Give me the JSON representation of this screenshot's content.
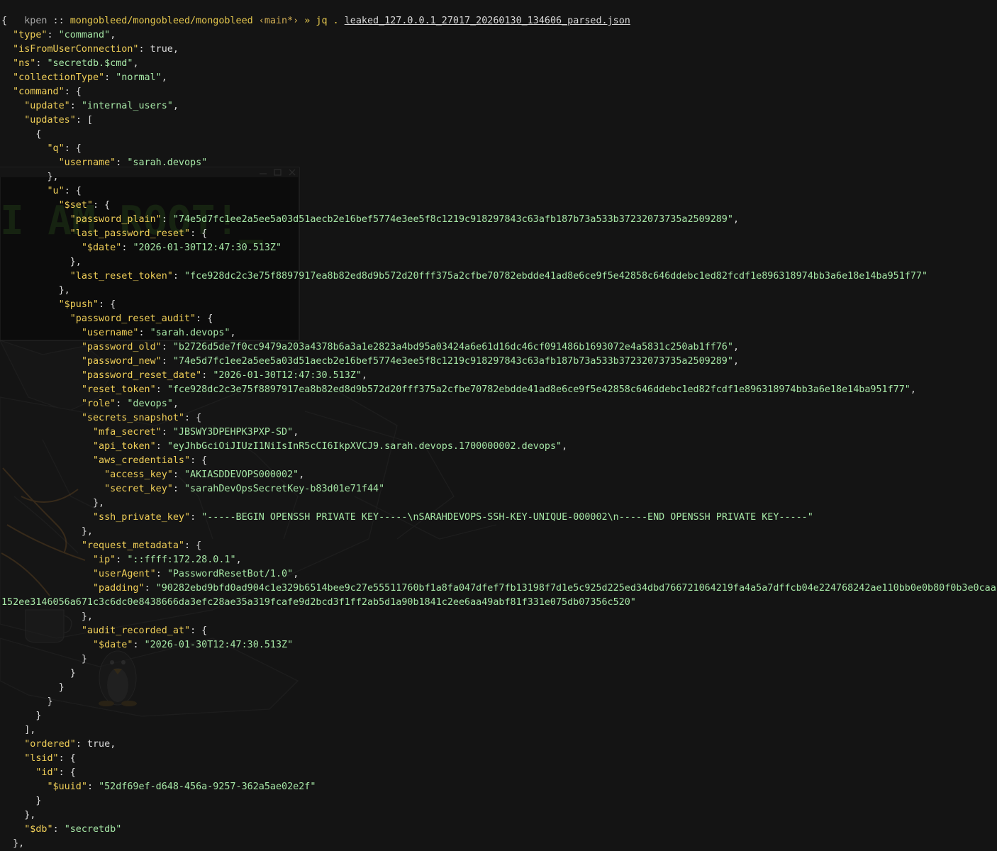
{
  "prompt": {
    "user": "kpen",
    "separator": " :: ",
    "path": "mongobleed/mongobleed/mongobleed",
    "branch": " ‹main*›",
    "arrow": " » ",
    "command": "jq . ",
    "filename": "leaked_127.0.0.1_27017_20260130_134606_parsed.json"
  },
  "output_lines": [
    {
      "indent": 0,
      "parts": [
        {
          "c": "p",
          "v": "{"
        }
      ]
    },
    {
      "indent": 1,
      "parts": [
        {
          "c": "k",
          "v": "\"type\""
        },
        {
          "c": "p",
          "v": ": "
        },
        {
          "c": "s",
          "v": "\"command\""
        },
        {
          "c": "p",
          "v": ","
        }
      ]
    },
    {
      "indent": 1,
      "parts": [
        {
          "c": "k",
          "v": "\"isFromUserConnection\""
        },
        {
          "c": "p",
          "v": ": "
        },
        {
          "c": "t",
          "v": "true"
        },
        {
          "c": "p",
          "v": ","
        }
      ]
    },
    {
      "indent": 1,
      "parts": [
        {
          "c": "k",
          "v": "\"ns\""
        },
        {
          "c": "p",
          "v": ": "
        },
        {
          "c": "s",
          "v": "\"secretdb.$cmd\""
        },
        {
          "c": "p",
          "v": ","
        }
      ]
    },
    {
      "indent": 1,
      "parts": [
        {
          "c": "k",
          "v": "\"collectionType\""
        },
        {
          "c": "p",
          "v": ": "
        },
        {
          "c": "s",
          "v": "\"normal\""
        },
        {
          "c": "p",
          "v": ","
        }
      ]
    },
    {
      "indent": 1,
      "parts": [
        {
          "c": "k",
          "v": "\"command\""
        },
        {
          "c": "p",
          "v": ": {"
        }
      ]
    },
    {
      "indent": 2,
      "parts": [
        {
          "c": "k",
          "v": "\"update\""
        },
        {
          "c": "p",
          "v": ": "
        },
        {
          "c": "s",
          "v": "\"internal_users\""
        },
        {
          "c": "p",
          "v": ","
        }
      ]
    },
    {
      "indent": 2,
      "parts": [
        {
          "c": "k",
          "v": "\"updates\""
        },
        {
          "c": "p",
          "v": ": ["
        }
      ]
    },
    {
      "indent": 3,
      "parts": [
        {
          "c": "p",
          "v": "{"
        }
      ]
    },
    {
      "indent": 4,
      "parts": [
        {
          "c": "k",
          "v": "\"q\""
        },
        {
          "c": "p",
          "v": ": {"
        }
      ]
    },
    {
      "indent": 5,
      "parts": [
        {
          "c": "k",
          "v": "\"username\""
        },
        {
          "c": "p",
          "v": ": "
        },
        {
          "c": "s",
          "v": "\"sarah.devops\""
        }
      ]
    },
    {
      "indent": 4,
      "parts": [
        {
          "c": "p",
          "v": "},"
        }
      ]
    },
    {
      "indent": 4,
      "parts": [
        {
          "c": "k",
          "v": "\"u\""
        },
        {
          "c": "p",
          "v": ": {"
        }
      ]
    },
    {
      "indent": 5,
      "parts": [
        {
          "c": "k",
          "v": "\"$set\""
        },
        {
          "c": "p",
          "v": ": {"
        }
      ]
    },
    {
      "indent": 6,
      "parts": [
        {
          "c": "k",
          "v": "\"password_plain\""
        },
        {
          "c": "p",
          "v": ": "
        },
        {
          "c": "s",
          "v": "\"74e5d7fc1ee2a5ee5a03d51aecb2e16bef5774e3ee5f8c1219c918297843c63afb187b73a533b37232073735a2509289\""
        },
        {
          "c": "p",
          "v": ","
        }
      ]
    },
    {
      "indent": 6,
      "parts": [
        {
          "c": "k",
          "v": "\"last_password_reset\""
        },
        {
          "c": "p",
          "v": ": {"
        }
      ]
    },
    {
      "indent": 7,
      "parts": [
        {
          "c": "k",
          "v": "\"$date\""
        },
        {
          "c": "p",
          "v": ": "
        },
        {
          "c": "s",
          "v": "\"2026-01-30T12:47:30.513Z\""
        }
      ]
    },
    {
      "indent": 6,
      "parts": [
        {
          "c": "p",
          "v": "},"
        }
      ]
    },
    {
      "indent": 6,
      "parts": [
        {
          "c": "k",
          "v": "\"last_reset_token\""
        },
        {
          "c": "p",
          "v": ": "
        },
        {
          "c": "s",
          "v": "\"fce928dc2c3e75f8897917ea8b82ed8d9b572d20fff375a2cfbe70782ebdde41ad8e6ce9f5e42858c646ddebc1ed82fcdf1e896318974bb3a6e18e14ba951f77\""
        }
      ]
    },
    {
      "indent": 5,
      "parts": [
        {
          "c": "p",
          "v": "},"
        }
      ]
    },
    {
      "indent": 5,
      "parts": [
        {
          "c": "k",
          "v": "\"$push\""
        },
        {
          "c": "p",
          "v": ": {"
        }
      ]
    },
    {
      "indent": 6,
      "parts": [
        {
          "c": "k",
          "v": "\"password_reset_audit\""
        },
        {
          "c": "p",
          "v": ": {"
        }
      ]
    },
    {
      "indent": 7,
      "parts": [
        {
          "c": "k",
          "v": "\"username\""
        },
        {
          "c": "p",
          "v": ": "
        },
        {
          "c": "s",
          "v": "\"sarah.devops\""
        },
        {
          "c": "p",
          "v": ","
        }
      ]
    },
    {
      "indent": 7,
      "parts": [
        {
          "c": "k",
          "v": "\"password_old\""
        },
        {
          "c": "p",
          "v": ": "
        },
        {
          "c": "s",
          "v": "\"b2726d5de7f0cc9479a203a4378b6a3a1e2823a4bd95a03424a6e61d16dc46cf091486b1693072e4a5831c250ab1ff76\""
        },
        {
          "c": "p",
          "v": ","
        }
      ]
    },
    {
      "indent": 7,
      "parts": [
        {
          "c": "k",
          "v": "\"password_new\""
        },
        {
          "c": "p",
          "v": ": "
        },
        {
          "c": "s",
          "v": "\"74e5d7fc1ee2a5ee5a03d51aecb2e16bef5774e3ee5f8c1219c918297843c63afb187b73a533b37232073735a2509289\""
        },
        {
          "c": "p",
          "v": ","
        }
      ]
    },
    {
      "indent": 7,
      "parts": [
        {
          "c": "k",
          "v": "\"password_reset_date\""
        },
        {
          "c": "p",
          "v": ": "
        },
        {
          "c": "s",
          "v": "\"2026-01-30T12:47:30.513Z\""
        },
        {
          "c": "p",
          "v": ","
        }
      ]
    },
    {
      "indent": 7,
      "parts": [
        {
          "c": "k",
          "v": "\"reset_token\""
        },
        {
          "c": "p",
          "v": ": "
        },
        {
          "c": "s",
          "v": "\"fce928dc2c3e75f8897917ea8b82ed8d9b572d20fff375a2cfbe70782ebdde41ad8e6ce9f5e42858c646ddebc1ed82fcdf1e896318974bb3a6e18e14ba951f77\""
        },
        {
          "c": "p",
          "v": ","
        }
      ]
    },
    {
      "indent": 7,
      "parts": [
        {
          "c": "k",
          "v": "\"role\""
        },
        {
          "c": "p",
          "v": ": "
        },
        {
          "c": "s",
          "v": "\"devops\""
        },
        {
          "c": "p",
          "v": ","
        }
      ]
    },
    {
      "indent": 7,
      "parts": [
        {
          "c": "k",
          "v": "\"secrets_snapshot\""
        },
        {
          "c": "p",
          "v": ": {"
        }
      ]
    },
    {
      "indent": 8,
      "parts": [
        {
          "c": "k",
          "v": "\"mfa_secret\""
        },
        {
          "c": "p",
          "v": ": "
        },
        {
          "c": "s",
          "v": "\"JBSWY3DPEHPK3PXP-SD\""
        },
        {
          "c": "p",
          "v": ","
        }
      ]
    },
    {
      "indent": 8,
      "parts": [
        {
          "c": "k",
          "v": "\"api_token\""
        },
        {
          "c": "p",
          "v": ": "
        },
        {
          "c": "s",
          "v": "\"eyJhbGciOiJIUzI1NiIsInR5cCI6IkpXVCJ9.sarah.devops.1700000002.devops\""
        },
        {
          "c": "p",
          "v": ","
        }
      ]
    },
    {
      "indent": 8,
      "parts": [
        {
          "c": "k",
          "v": "\"aws_credentials\""
        },
        {
          "c": "p",
          "v": ": {"
        }
      ]
    },
    {
      "indent": 9,
      "parts": [
        {
          "c": "k",
          "v": "\"access_key\""
        },
        {
          "c": "p",
          "v": ": "
        },
        {
          "c": "s",
          "v": "\"AKIASDDEVOPS000002\""
        },
        {
          "c": "p",
          "v": ","
        }
      ]
    },
    {
      "indent": 9,
      "parts": [
        {
          "c": "k",
          "v": "\"secret_key\""
        },
        {
          "c": "p",
          "v": ": "
        },
        {
          "c": "s",
          "v": "\"sarahDevOpsSecretKey-b83d01e71f44\""
        }
      ]
    },
    {
      "indent": 8,
      "parts": [
        {
          "c": "p",
          "v": "},"
        }
      ]
    },
    {
      "indent": 8,
      "parts": [
        {
          "c": "k",
          "v": "\"ssh_private_key\""
        },
        {
          "c": "p",
          "v": ": "
        },
        {
          "c": "s",
          "v": "\"-----BEGIN OPENSSH PRIVATE KEY-----\\nSARAHDEVOPS-SSH-KEY-UNIQUE-000002\\n-----END OPENSSH PRIVATE KEY-----\""
        }
      ]
    },
    {
      "indent": 7,
      "parts": [
        {
          "c": "p",
          "v": "},"
        }
      ]
    },
    {
      "indent": 7,
      "parts": [
        {
          "c": "k",
          "v": "\"request_metadata\""
        },
        {
          "c": "p",
          "v": ": {"
        }
      ]
    },
    {
      "indent": 8,
      "parts": [
        {
          "c": "k",
          "v": "\"ip\""
        },
        {
          "c": "p",
          "v": ": "
        },
        {
          "c": "s",
          "v": "\"::ffff:172.28.0.1\""
        },
        {
          "c": "p",
          "v": ","
        }
      ]
    },
    {
      "indent": 8,
      "parts": [
        {
          "c": "k",
          "v": "\"userAgent\""
        },
        {
          "c": "p",
          "v": ": "
        },
        {
          "c": "s",
          "v": "\"PasswordResetBot/1.0\""
        },
        {
          "c": "p",
          "v": ","
        }
      ]
    },
    {
      "indent": 8,
      "wrap": true,
      "parts": [
        {
          "c": "k",
          "v": "\"padding\""
        },
        {
          "c": "p",
          "v": ": "
        },
        {
          "c": "s",
          "v": "\"90282ebd9bfd0ad904c1e329b6514bee9c27e55511760bf1a8fa047dfef7fb13198f7d1e5c925d225ed34dbd766721064219fa4a5a7dffcb04e224768242ae110bb0e0b80f0b3e0caa152ee3146056a671c3c6dc0e8438666da3efc28ae35a319fcafe9d2bcd3f1ff2ab5d1a90b1841c2ee6aa49abf81f331e075db07356c520\""
        }
      ]
    },
    {
      "indent": 7,
      "parts": [
        {
          "c": "p",
          "v": "},"
        }
      ]
    },
    {
      "indent": 7,
      "parts": [
        {
          "c": "k",
          "v": "\"audit_recorded_at\""
        },
        {
          "c": "p",
          "v": ": {"
        }
      ]
    },
    {
      "indent": 8,
      "parts": [
        {
          "c": "k",
          "v": "\"$date\""
        },
        {
          "c": "p",
          "v": ": "
        },
        {
          "c": "s",
          "v": "\"2026-01-30T12:47:30.513Z\""
        }
      ]
    },
    {
      "indent": 7,
      "parts": [
        {
          "c": "p",
          "v": "}"
        }
      ]
    },
    {
      "indent": 6,
      "parts": [
        {
          "c": "p",
          "v": "}"
        }
      ]
    },
    {
      "indent": 5,
      "parts": [
        {
          "c": "p",
          "v": "}"
        }
      ]
    },
    {
      "indent": 4,
      "parts": [
        {
          "c": "p",
          "v": "}"
        }
      ]
    },
    {
      "indent": 3,
      "parts": [
        {
          "c": "p",
          "v": "}"
        }
      ]
    },
    {
      "indent": 2,
      "parts": [
        {
          "c": "p",
          "v": "],"
        }
      ]
    },
    {
      "indent": 2,
      "parts": [
        {
          "c": "k",
          "v": "\"ordered\""
        },
        {
          "c": "p",
          "v": ": "
        },
        {
          "c": "t",
          "v": "true"
        },
        {
          "c": "p",
          "v": ","
        }
      ]
    },
    {
      "indent": 2,
      "parts": [
        {
          "c": "k",
          "v": "\"lsid\""
        },
        {
          "c": "p",
          "v": ": {"
        }
      ]
    },
    {
      "indent": 3,
      "parts": [
        {
          "c": "k",
          "v": "\"id\""
        },
        {
          "c": "p",
          "v": ": {"
        }
      ]
    },
    {
      "indent": 4,
      "parts": [
        {
          "c": "k",
          "v": "\"$uuid\""
        },
        {
          "c": "p",
          "v": ": "
        },
        {
          "c": "s",
          "v": "\"52df69ef-d648-456a-9257-362a5ae02e2f\""
        }
      ]
    },
    {
      "indent": 3,
      "parts": [
        {
          "c": "p",
          "v": "}"
        }
      ]
    },
    {
      "indent": 2,
      "parts": [
        {
          "c": "p",
          "v": "},"
        }
      ]
    },
    {
      "indent": 2,
      "parts": [
        {
          "c": "k",
          "v": "\"$db\""
        },
        {
          "c": "p",
          "v": ": "
        },
        {
          "c": "s",
          "v": "\"secretdb\""
        }
      ]
    },
    {
      "indent": 1,
      "parts": [
        {
          "c": "p",
          "v": "},"
        }
      ]
    }
  ],
  "background": {
    "wallpaper_text": "I AM ROOT!_"
  }
}
